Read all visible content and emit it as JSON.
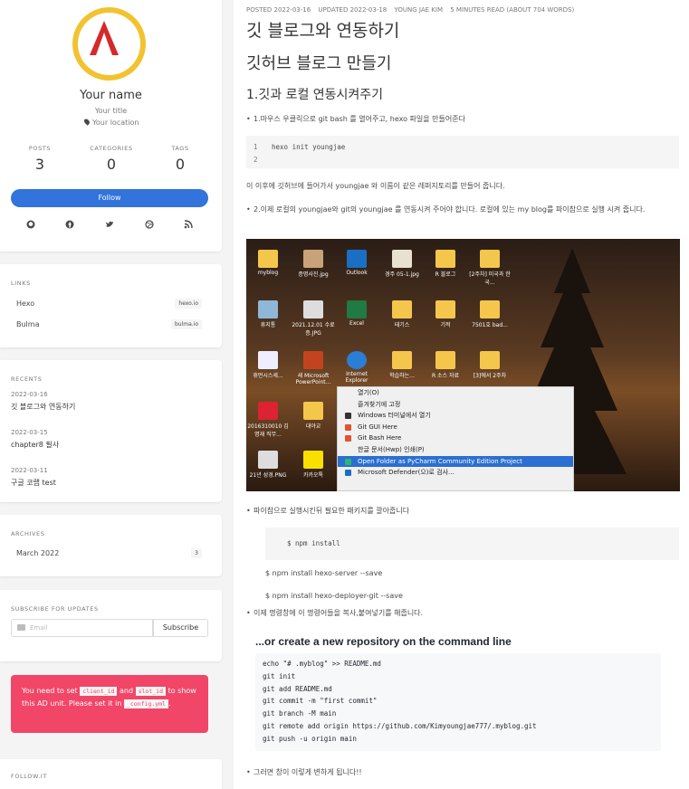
{
  "profile": {
    "name": "Your name",
    "title": "Your title",
    "location": "Your location",
    "stats": [
      {
        "label": "POSTS",
        "value": "3"
      },
      {
        "label": "CATEGORIES",
        "value": "0"
      },
      {
        "label": "TAGS",
        "value": "0"
      }
    ],
    "follow_label": "Follow"
  },
  "links": {
    "title": "LINKS",
    "items": [
      {
        "label": "Hexo",
        "tag": "hexo.io"
      },
      {
        "label": "Bulma",
        "tag": "bulma.io"
      }
    ]
  },
  "recents": {
    "title": "RECENTS",
    "items": [
      {
        "date": "2022-03-16",
        "title": "깃 블로그와 연동하기"
      },
      {
        "date": "2022-03-15",
        "title": "chapter8 필사"
      },
      {
        "date": "2022-03-11",
        "title": "구글 코랩 test"
      }
    ]
  },
  "archives": {
    "title": "ARCHIVES",
    "items": [
      {
        "label": "March 2022",
        "count": "3"
      }
    ]
  },
  "subscribe": {
    "title": "SUBSCRIBE FOR UPDATES",
    "placeholder": "Email",
    "button": "Subscribe"
  },
  "ad": {
    "t1": "You need to set",
    "c1": "client_id",
    "t2": "and",
    "c2": "slot_id",
    "t3": "to show this AD unit. Please set it in",
    "c3": "_config.yml",
    "t4": "."
  },
  "followit": {
    "title": "FOLLOW.IT"
  },
  "post": {
    "posted": "POSTED 2022-03-16",
    "updated": "UPDATED 2022-03-18",
    "author": "YOUNG JAE KIM",
    "read": "5 MINUTES READ (ABOUT 704 WORDS)",
    "h1": "깃 블로그와 연동하기",
    "h2": "깃허브 블로그 만들기",
    "h3": "1.깃과 로컬 연동시켜주기",
    "bullet1": "1.마우스 우클릭으로 git bash 를 열어주고, hexo 파일을 만들어준다",
    "code1": "hexo init youngjae",
    "para1": "이 이후에 깃허브에 들어가서 youngjae 와 이름이 같은 레퍼지토리를 만들어 줍니다.",
    "bullet2": "2.이제 로컬의 youngjae와 git의 youngjae 를 연동시켜 주어야 합니다. 로컬에 있는 my blog를 파이참으로 실행 시켜 줍니다.",
    "bullet3": "파이참으로 실행시킨뒤 필요한 패키지를 깔아줍니다",
    "npm_code": "$ npm install",
    "npm_server": "$ npm install hexo-server --save",
    "npm_deployer": "$ npm install hexo-deployer-git --save",
    "bullet4": "이제 명령창에 이 명령어들을 복사,붙여넣기를 해줍니다.",
    "gh_title": "...or create a new repository on the command line",
    "gh_code": "echo \"# .myblog\" >> README.md\ngit init\ngit add README.md\ngit commit -m \"first commit\"\ngit branch -M main\ngit remote add origin https://github.com/Kimyoungjae777/.myblog.git\ngit push -u origin main",
    "bullet5": "그러면 창이 이렇게 변하게 됩니다!!"
  },
  "desktop": {
    "icons": [
      "myblog",
      "증명사진.jpg",
      "Outlook",
      "경주 05-1.jpg",
      "R 블로그",
      "[2주차] 미국과 한국...",
      "휴지통",
      "2021.12.01 수료증.JPG",
      "Excel",
      "테기스",
      "기적",
      "7501호 bad...",
      "휴먼시스세...",
      "새 Microsoft PowerPoint...",
      "Internet Explorer",
      "학습하는...",
      "R 소스 자료",
      "[3]에서 2주차",
      "2016310010 김명재 직무...",
      "대야교",
      "21년 성경.PNG",
      "카카오톡"
    ],
    "menu": [
      "열기(O)",
      "즐겨찾기에 고정",
      "Windows 터미널에서 열기",
      "Git GUI Here",
      "Git Bash Here",
      "한글 문서(Hwp) 인쇄(P)",
      "Open Folder as PyCharm Community Edition Project",
      "Microsoft Defender(으)로 검사..."
    ]
  },
  "colors": {
    "accent": "#3273dc",
    "ad": "#f14668",
    "avatar": "#f2c230"
  }
}
